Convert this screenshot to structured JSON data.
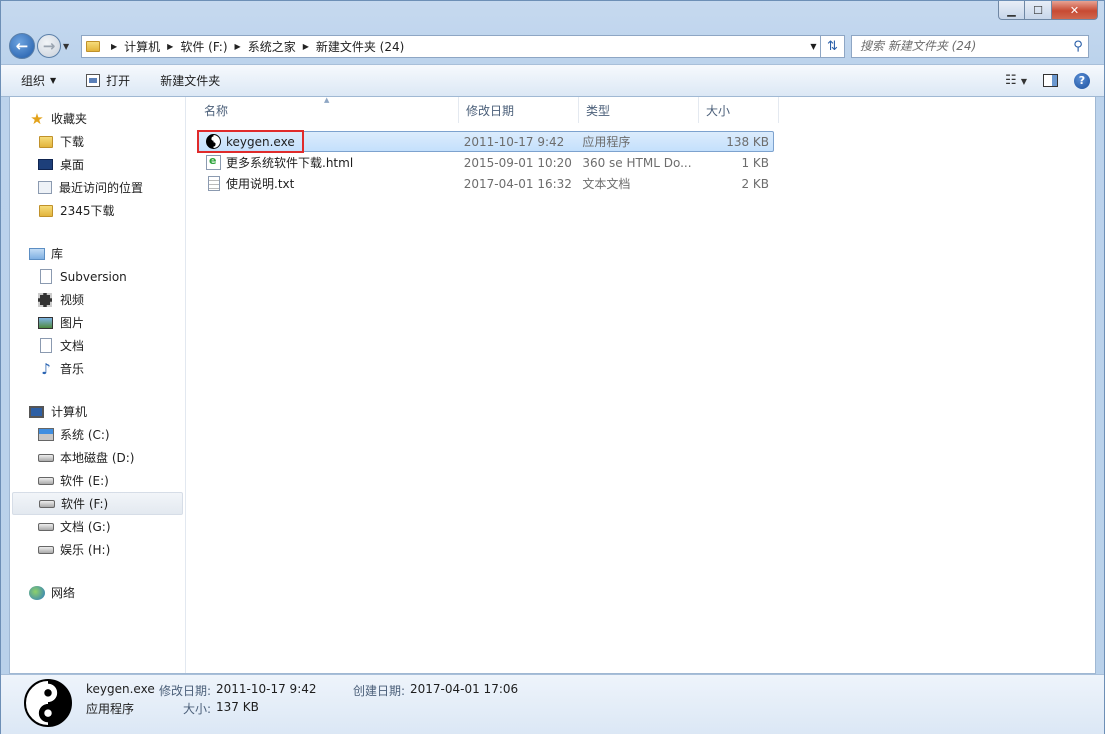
{
  "window": {
    "minimize": "▁",
    "maximize": "☐",
    "close": "✕"
  },
  "address": {
    "crumbs": [
      "计算机",
      "软件 (F:)",
      "系统之家",
      "新建文件夹 (24)"
    ],
    "search_placeholder": "搜索 新建文件夹 (24)"
  },
  "toolbar": {
    "organize": "组织",
    "open": "打开",
    "new_folder": "新建文件夹"
  },
  "sidebar": {
    "favorites": {
      "label": "收藏夹",
      "items": [
        "下载",
        "桌面",
        "最近访问的位置",
        "2345下载"
      ]
    },
    "libraries": {
      "label": "库",
      "items": [
        "Subversion",
        "视频",
        "图片",
        "文档",
        "音乐"
      ]
    },
    "computer": {
      "label": "计算机",
      "items": [
        "系统 (C:)",
        "本地磁盘 (D:)",
        "软件 (E:)",
        "软件 (F:)",
        "文档 (G:)",
        "娱乐 (H:)"
      ],
      "selected": "软件 (F:)"
    },
    "network": {
      "label": "网络"
    }
  },
  "columns": {
    "name": "名称",
    "date": "修改日期",
    "type": "类型",
    "size": "大小"
  },
  "files": [
    {
      "name": "keygen.exe",
      "date": "2011-10-17 9:42",
      "type": "应用程序",
      "size": "138 KB",
      "icon": "yin-yang-icon",
      "selected": true
    },
    {
      "name": "更多系统软件下载.html",
      "date": "2015-09-01 10:20",
      "type": "360 se HTML Do...",
      "size": "1 KB",
      "icon": "html-file-icon",
      "selected": false
    },
    {
      "name": "使用说明.txt",
      "date": "2017-04-01 16:32",
      "type": "文本文档",
      "size": "2 KB",
      "icon": "text-file-icon",
      "selected": false
    }
  ],
  "details": {
    "filename": "keygen.exe",
    "type": "应用程序",
    "modified_label": "修改日期:",
    "modified": "2011-10-17 9:42",
    "created_label": "创建日期:",
    "created": "2017-04-01 17:06",
    "size_label": "大小:",
    "size": "137 KB"
  },
  "colors": {
    "selection": "#cce4fc",
    "highlight_box": "#e02b2b",
    "accent": "#1f5aa8"
  }
}
